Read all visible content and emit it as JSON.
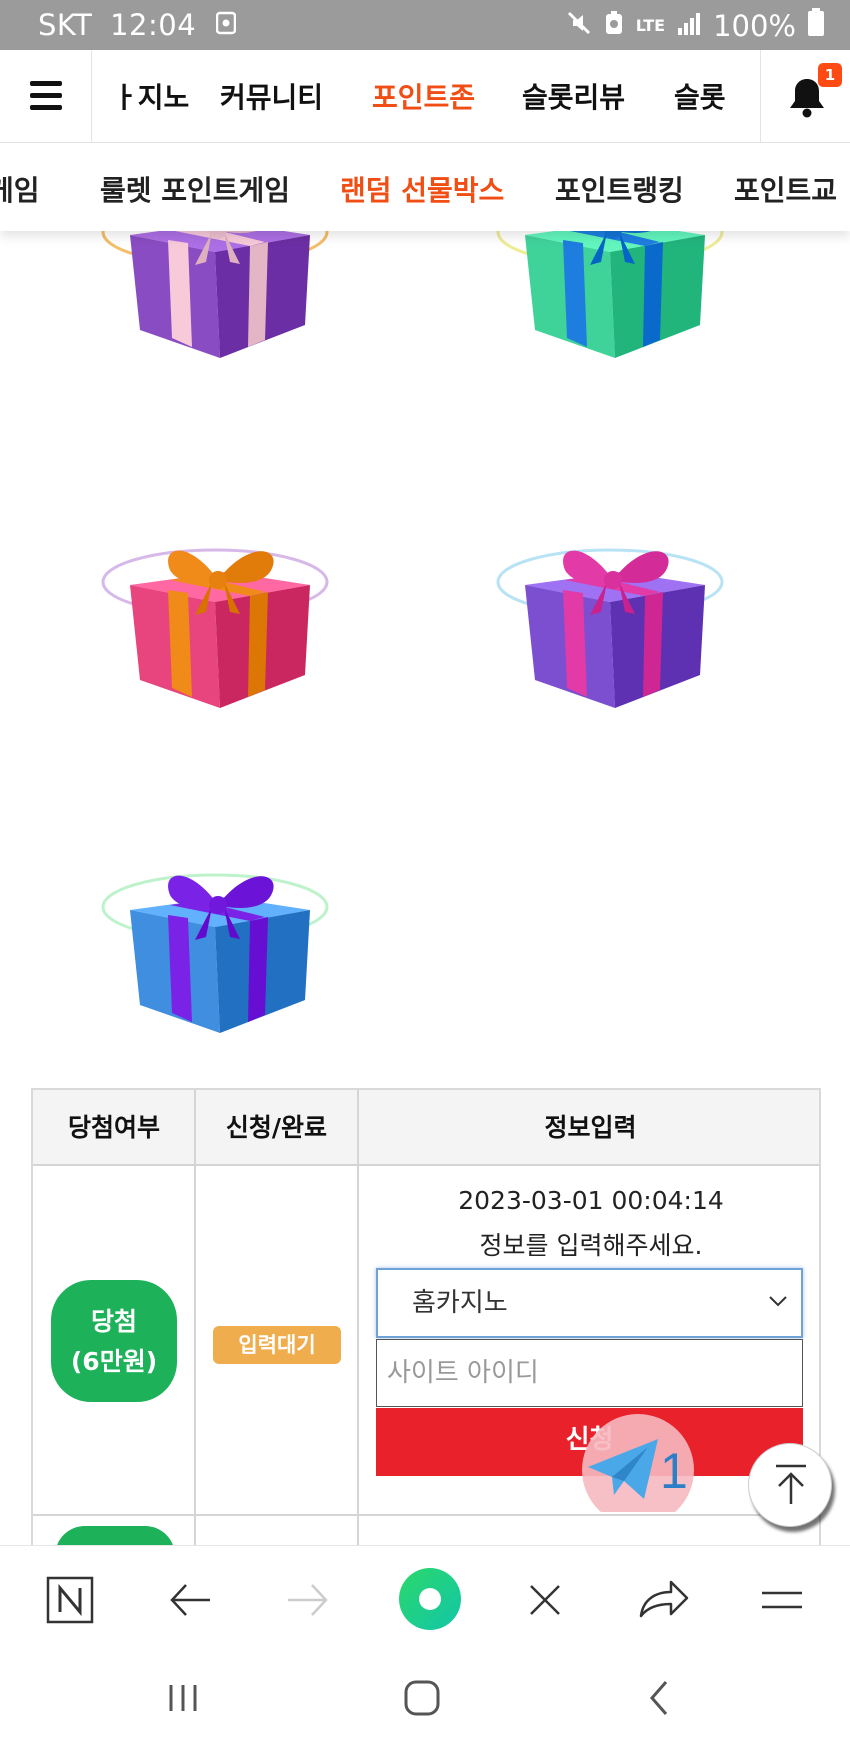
{
  "status_bar": {
    "carrier": "SKT",
    "time": "12:04",
    "network": "LTE",
    "battery": "100%"
  },
  "top_nav": {
    "items": [
      "ㅏ지노",
      "커뮤니티",
      "포인트존",
      "슬롯리뷰",
      "슬롯"
    ],
    "active_index": 2,
    "notification_count": "1"
  },
  "sub_nav": {
    "items": [
      "게임",
      "룰렛 포인트게임",
      "랜덤 선물박스",
      "포인트랭킹",
      "포인트교"
    ],
    "active_index": 2
  },
  "gifts": [
    {
      "box": "#8a4cc2",
      "ribbon": "#f7c9d9",
      "ring": "#f0a32a"
    },
    {
      "box": "#3fd39a",
      "ribbon": "#1e7ee0",
      "ring": "#e8e46a"
    },
    {
      "box": "#e8457f",
      "ribbon": "#f08a18",
      "ring": "#c59be0"
    },
    {
      "box": "#7b4fd0",
      "ribbon": "#e23aa6",
      "ring": "#9ad7f0"
    },
    {
      "box": "#3f8ee0",
      "ribbon": "#7a22e6",
      "ring": "#a3ecb4"
    }
  ],
  "table": {
    "headers": [
      "당첨여부",
      "신청/완료",
      "정보입력"
    ],
    "row": {
      "result_line1": "당첨",
      "result_line2": "(6만원)",
      "status": "입력대기",
      "datetime": "2023-03-01 00:04:14",
      "prompt": "정보를 입력해주세요.",
      "site_select_value": "홈카지노",
      "id_placeholder": "사이트 아이디",
      "apply_label": "신청"
    }
  },
  "floating": {
    "telegram_count": "1"
  },
  "colors": {
    "accent": "#f04e14",
    "win_green": "#1db15a",
    "pending_orange": "#f0ad4e",
    "apply_red": "#e8212a"
  }
}
